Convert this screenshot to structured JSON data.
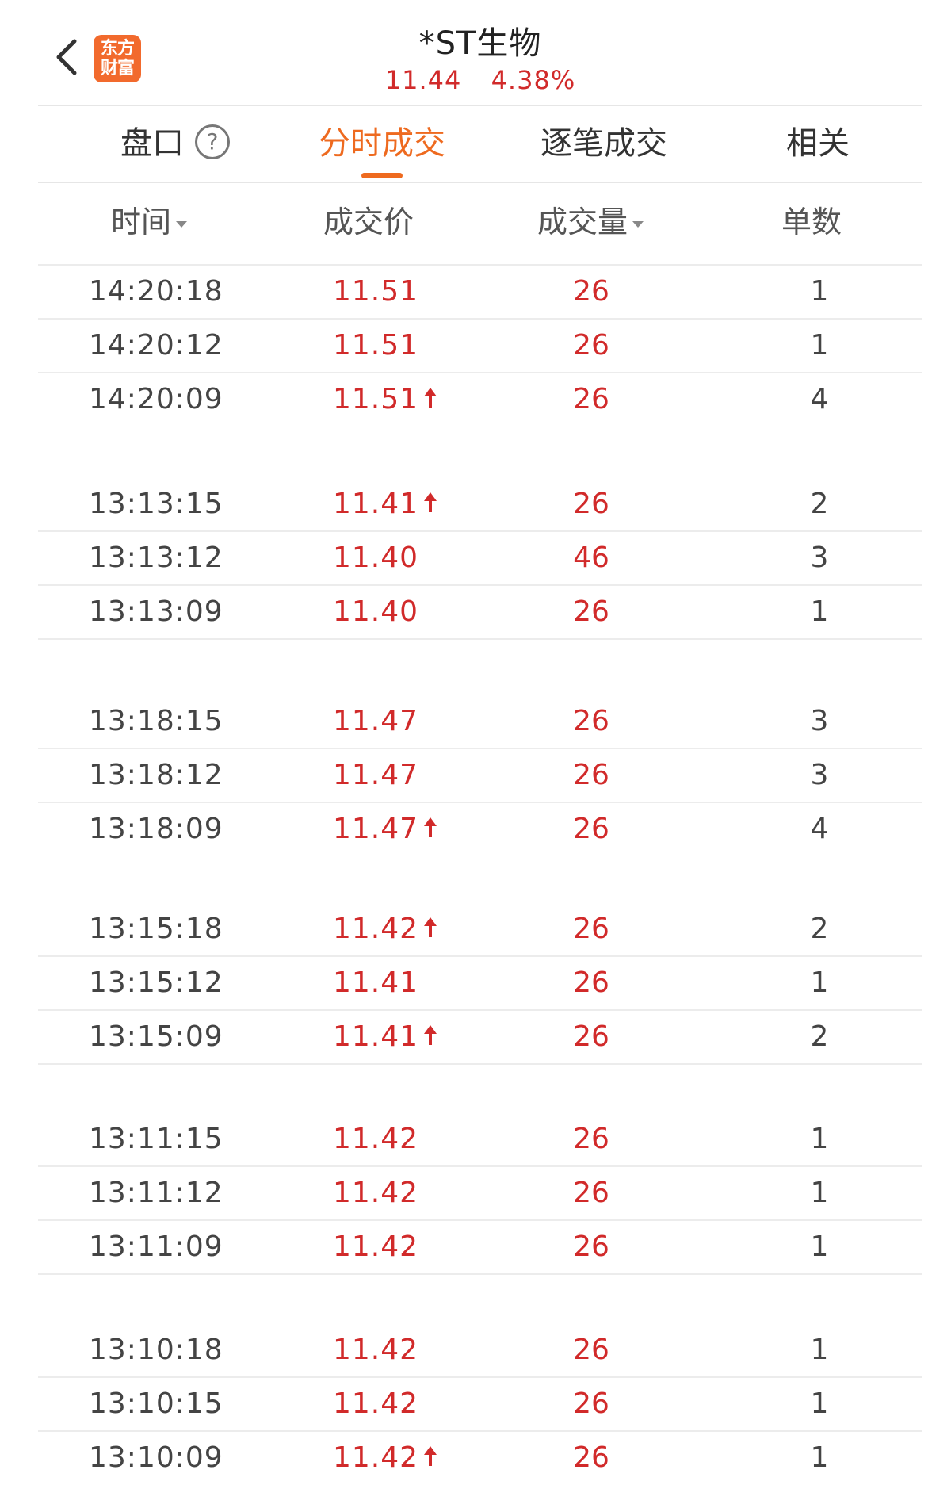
{
  "header": {
    "title": "*ST生物",
    "price": "11.44",
    "change_pct": "4.38%",
    "logo_line1": "东方",
    "logo_line2": "财富"
  },
  "tabs": [
    {
      "label": "盘口",
      "active": false
    },
    {
      "label": "分时成交",
      "active": true
    },
    {
      "label": "逐笔成交",
      "active": false
    },
    {
      "label": "相关",
      "active": false
    }
  ],
  "columns": {
    "time": "时间",
    "price": "成交价",
    "volume": "成交量",
    "count": "单数"
  },
  "colors": {
    "accent": "#ee6a1f",
    "up": "#d12a2a",
    "logo_bg": "#f26a2d"
  },
  "rows": [
    {
      "time": "14:20:18",
      "price": "11.51",
      "up": false,
      "volume": "26",
      "count": "1"
    },
    {
      "time": "14:20:12",
      "price": "11.51",
      "up": false,
      "volume": "26",
      "count": "1"
    },
    {
      "time": "14:20:09",
      "price": "11.51",
      "up": true,
      "volume": "26",
      "count": "4"
    },
    {
      "time": "13:13:15",
      "price": "11.41",
      "up": true,
      "volume": "26",
      "count": "2"
    },
    {
      "time": "13:13:12",
      "price": "11.40",
      "up": false,
      "volume": "46",
      "count": "3"
    },
    {
      "time": "13:13:09",
      "price": "11.40",
      "up": false,
      "volume": "26",
      "count": "1"
    },
    {
      "time": "13:18:15",
      "price": "11.47",
      "up": false,
      "volume": "26",
      "count": "3"
    },
    {
      "time": "13:18:12",
      "price": "11.47",
      "up": false,
      "volume": "26",
      "count": "3"
    },
    {
      "time": "13:18:09",
      "price": "11.47",
      "up": true,
      "volume": "26",
      "count": "4"
    },
    {
      "time": "13:15:18",
      "price": "11.42",
      "up": true,
      "volume": "26",
      "count": "2"
    },
    {
      "time": "13:15:12",
      "price": "11.41",
      "up": false,
      "volume": "26",
      "count": "1"
    },
    {
      "time": "13:15:09",
      "price": "11.41",
      "up": true,
      "volume": "26",
      "count": "2"
    },
    {
      "time": "13:11:15",
      "price": "11.42",
      "up": false,
      "volume": "26",
      "count": "1"
    },
    {
      "time": "13:11:12",
      "price": "11.42",
      "up": false,
      "volume": "26",
      "count": "1"
    },
    {
      "time": "13:11:09",
      "price": "11.42",
      "up": false,
      "volume": "26",
      "count": "1"
    },
    {
      "time": "13:10:18",
      "price": "11.42",
      "up": false,
      "volume": "26",
      "count": "1"
    },
    {
      "time": "13:10:15",
      "price": "11.42",
      "up": false,
      "volume": "26",
      "count": "1"
    },
    {
      "time": "13:10:09",
      "price": "11.42",
      "up": true,
      "volume": "26",
      "count": "1"
    }
  ]
}
